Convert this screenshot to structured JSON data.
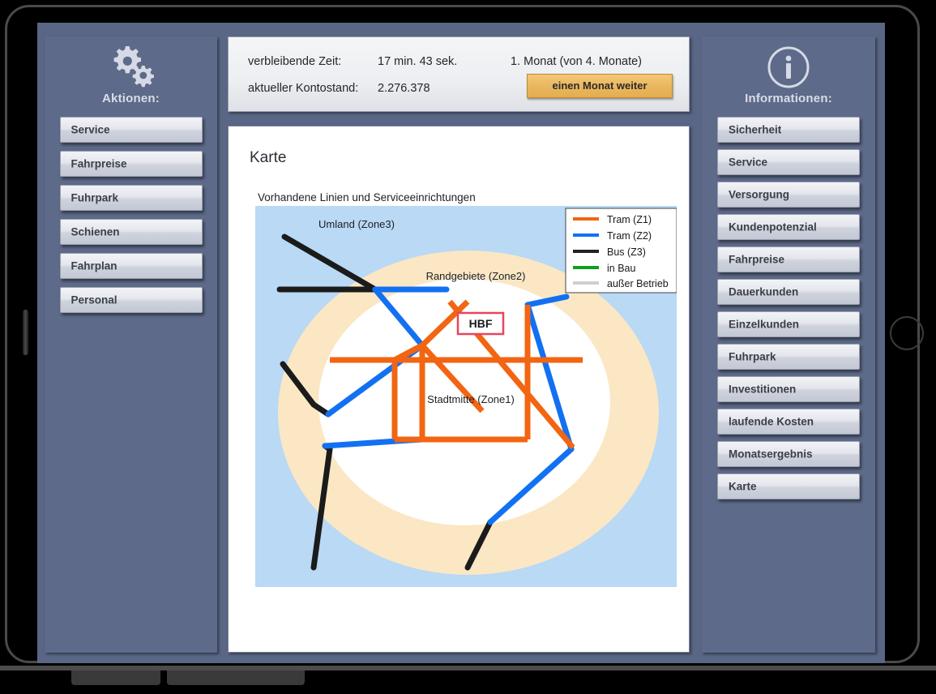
{
  "window": {
    "app_background": "#596685",
    "panel_background": "#5d6a89"
  },
  "topbar": {
    "time_label": "verbleibende Zeit:",
    "time_value": "17 min. 43 sek.",
    "balance_label": "aktueller Kontostand:",
    "balance_value": "2.276.378",
    "month_indicator": "1. Monat (von 4. Monate)",
    "next_month_button": "einen Monat weiter",
    "next_month_color": "#eab75f"
  },
  "left_sidebar": {
    "icon": "gears-icon",
    "title": "Aktionen:",
    "items": [
      {
        "label": "Service"
      },
      {
        "label": "Fahrpreise"
      },
      {
        "label": "Fuhrpark"
      },
      {
        "label": "Schienen"
      },
      {
        "label": "Fahrplan"
      },
      {
        "label": "Personal"
      }
    ]
  },
  "right_sidebar": {
    "icon": "info-icon",
    "title": "Informationen:",
    "items": [
      {
        "label": "Sicherheit"
      },
      {
        "label": "Service"
      },
      {
        "label": "Versorgung"
      },
      {
        "label": "Kundenpotenzial"
      },
      {
        "label": "Fahrpreise"
      },
      {
        "label": "Dauerkunden"
      },
      {
        "label": "Einzelkunden"
      },
      {
        "label": "Fuhrpark"
      },
      {
        "label": "Investitionen"
      },
      {
        "label": "laufende Kosten"
      },
      {
        "label": "Monatsergebnis"
      },
      {
        "label": "Karte"
      }
    ]
  },
  "content": {
    "title": "Karte",
    "map": {
      "subtitle": "Vorhandene Linien und Serviceeinrichtungen",
      "background_color": "#b9d9f5",
      "zones": [
        {
          "name": "Umland (Zone3)",
          "color": "#b9d9f5"
        },
        {
          "name": "Randgebiete (Zone2)",
          "color": "#fbe7c4"
        },
        {
          "name": "Stadtmitte (Zone1)",
          "color": "#ffffff"
        }
      ],
      "station": {
        "label": "HBF",
        "border_color": "#e8455f"
      },
      "legend": [
        {
          "label": "Tram  (Z1)",
          "color": "#f26512"
        },
        {
          "label": "Tram  (Z2)",
          "color": "#1271f2"
        },
        {
          "label": "Bus    (Z3)",
          "color": "#222222"
        },
        {
          "label": "in Bau",
          "color": "#0f9e1f"
        },
        {
          "label": "außer Betrieb",
          "color": "#cfcfcf"
        }
      ]
    }
  }
}
